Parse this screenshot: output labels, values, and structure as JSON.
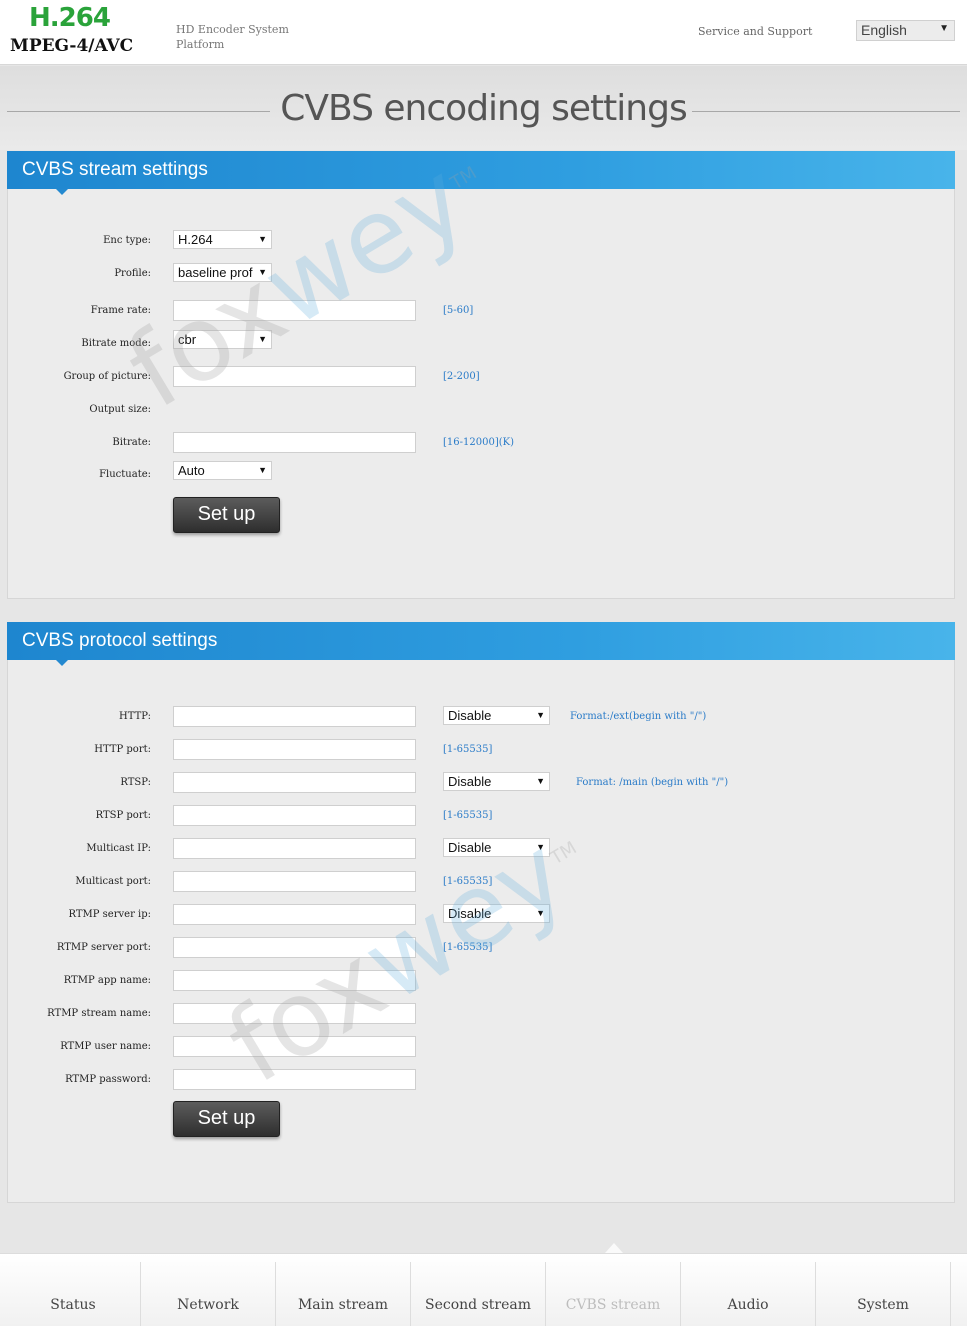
{
  "header": {
    "logo_top": "H.264",
    "logo_bottom": "MPEG-4/AVC",
    "subtitle": "HD Encoder System Platform",
    "service_link": "Service and Support",
    "language": "English"
  },
  "page_title": "CVBS encoding settings",
  "watermark": {
    "fox": "fox",
    "wey": "wey",
    "tm": "TM"
  },
  "stream_panel": {
    "title": "CVBS stream settings",
    "fields": {
      "enc_type": {
        "label": "Enc type:",
        "value": "H.264"
      },
      "profile": {
        "label": "Profile:",
        "value": "baseline prof"
      },
      "frame_rate": {
        "label": "Frame rate:",
        "value": "",
        "hint": "[5-60]"
      },
      "bitrate_mode": {
        "label": "Bitrate mode:",
        "value": "cbr"
      },
      "gop": {
        "label": "Group of picture:",
        "value": "",
        "hint": "[2-200]"
      },
      "output_size": {
        "label": "Output size:"
      },
      "bitrate": {
        "label": "Bitrate:",
        "value": "",
        "hint": "[16-12000](K)"
      },
      "fluctuate": {
        "label": "Fluctuate:",
        "value": "Auto"
      }
    },
    "setup_label": "Set up"
  },
  "protocol_panel": {
    "title": "CVBS protocol settings",
    "fields": {
      "http": {
        "label": "HTTP:",
        "value": "",
        "state": "Disable",
        "format": "Format:/ext(begin with \"/\")"
      },
      "http_port": {
        "label": "HTTP port:",
        "value": "",
        "hint": "[1-65535]"
      },
      "rtsp": {
        "label": "RTSP:",
        "value": "",
        "state": "Disable",
        "format": "Format: /main (begin with \"/\")"
      },
      "rtsp_port": {
        "label": "RTSP port:",
        "value": "",
        "hint": "[1-65535]"
      },
      "multicast_ip": {
        "label": "Multicast IP:",
        "value": "",
        "state": "Disable"
      },
      "multicast_port": {
        "label": "Multicast port:",
        "value": "",
        "hint": "[1-65535]"
      },
      "rtmp_server_ip": {
        "label": "RTMP server ip:",
        "value": "",
        "state": "Disable"
      },
      "rtmp_server_port": {
        "label": "RTMP server port:",
        "value": "",
        "hint": "[1-65535]"
      },
      "rtmp_app_name": {
        "label": "RTMP app name:",
        "value": ""
      },
      "rtmp_stream_name": {
        "label": "RTMP stream name:",
        "value": ""
      },
      "rtmp_user_name": {
        "label": "RTMP user name:",
        "value": ""
      },
      "rtmp_password": {
        "label": "RTMP password:",
        "value": ""
      }
    },
    "setup_label": "Set up"
  },
  "nav": {
    "items": [
      "Status",
      "Network",
      "Main stream",
      "Second stream",
      "CVBS stream",
      "Audio",
      "System"
    ],
    "active": "CVBS stream"
  }
}
